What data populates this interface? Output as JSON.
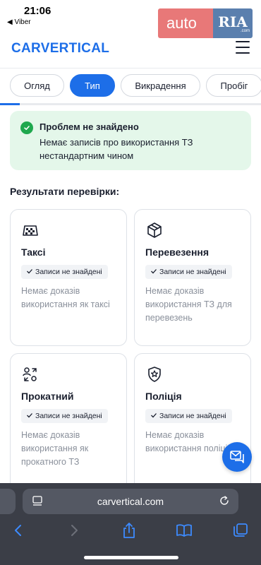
{
  "status_bar": {
    "time": "21:06",
    "back_label": "◀ Viber"
  },
  "ria": {
    "auto": "auto",
    "ria": "RIA",
    "domain": ".com"
  },
  "header": {
    "logo": "CARVERTICAL"
  },
  "tabs": [
    {
      "label": "Огляд",
      "active": false
    },
    {
      "label": "Тип",
      "active": true
    },
    {
      "label": "Викрадення",
      "active": false
    },
    {
      "label": "Пробіг",
      "active": false
    }
  ],
  "scroll_progress": 0.075,
  "alert": {
    "title": "Проблем не знайдено",
    "text": "Немає записів про використання ТЗ нестандартним чином"
  },
  "section_title": "Результати перевірки:",
  "cards": [
    {
      "icon": "taxi-icon",
      "title": "Таксі",
      "badge": "Записи не знайдені",
      "text": "Немає доказів використання як таксі"
    },
    {
      "icon": "box-icon",
      "title": "Перевезення",
      "badge": "Записи не знайдені",
      "text": "Немає доказів використання ТЗ для перевезень"
    },
    {
      "icon": "rental-icon",
      "title": "Прокатний",
      "badge": "Записи не знайдені",
      "text": "Немає доказів використання як прокатного ТЗ"
    },
    {
      "icon": "police-badge-icon",
      "title": "Поліція",
      "badge": "Записи не знайдені",
      "text": "Немає доказів використання поліцією"
    }
  ],
  "browser": {
    "url": "carvertical.com"
  },
  "colors": {
    "accent": "#1d6ee8",
    "success": "#1fa84e",
    "alert_bg": "#e4f7ea",
    "safari_bg": "#3b3e47"
  }
}
